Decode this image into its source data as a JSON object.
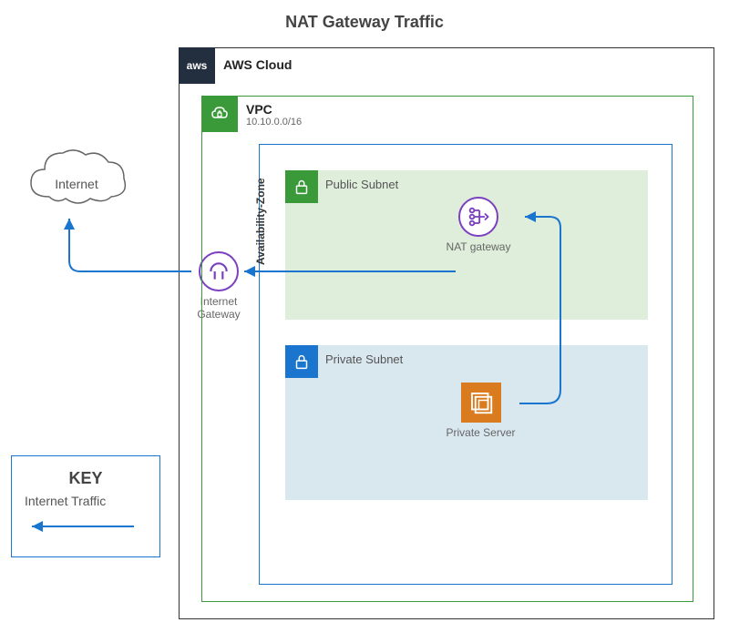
{
  "title": "NAT Gateway Traffic",
  "aws": {
    "badge": "aws",
    "label": "AWS Cloud"
  },
  "vpc": {
    "title": "VPC",
    "cidr": "10.10.0.0/16"
  },
  "az": {
    "label": "Availability-Zone"
  },
  "public_subnet": {
    "label": "Public Subnet"
  },
  "private_subnet": {
    "label": "Private Subnet"
  },
  "nat": {
    "label": "NAT gateway"
  },
  "igw": {
    "label": "Internet Gateway"
  },
  "server": {
    "label": "Private Server"
  },
  "internet": {
    "label": "Internet"
  },
  "key": {
    "title": "KEY",
    "legend": "Internet Traffic"
  },
  "colors": {
    "vpc_border": "#3a9a3a",
    "az_border": "#1a75cf",
    "public_bg": "#dfeedb",
    "private_bg": "#d9e7ef",
    "arrow": "#1a75cf",
    "purple": "#7b3fbf",
    "server_bg": "#d97b1e",
    "aws_bg": "#232f3e"
  }
}
